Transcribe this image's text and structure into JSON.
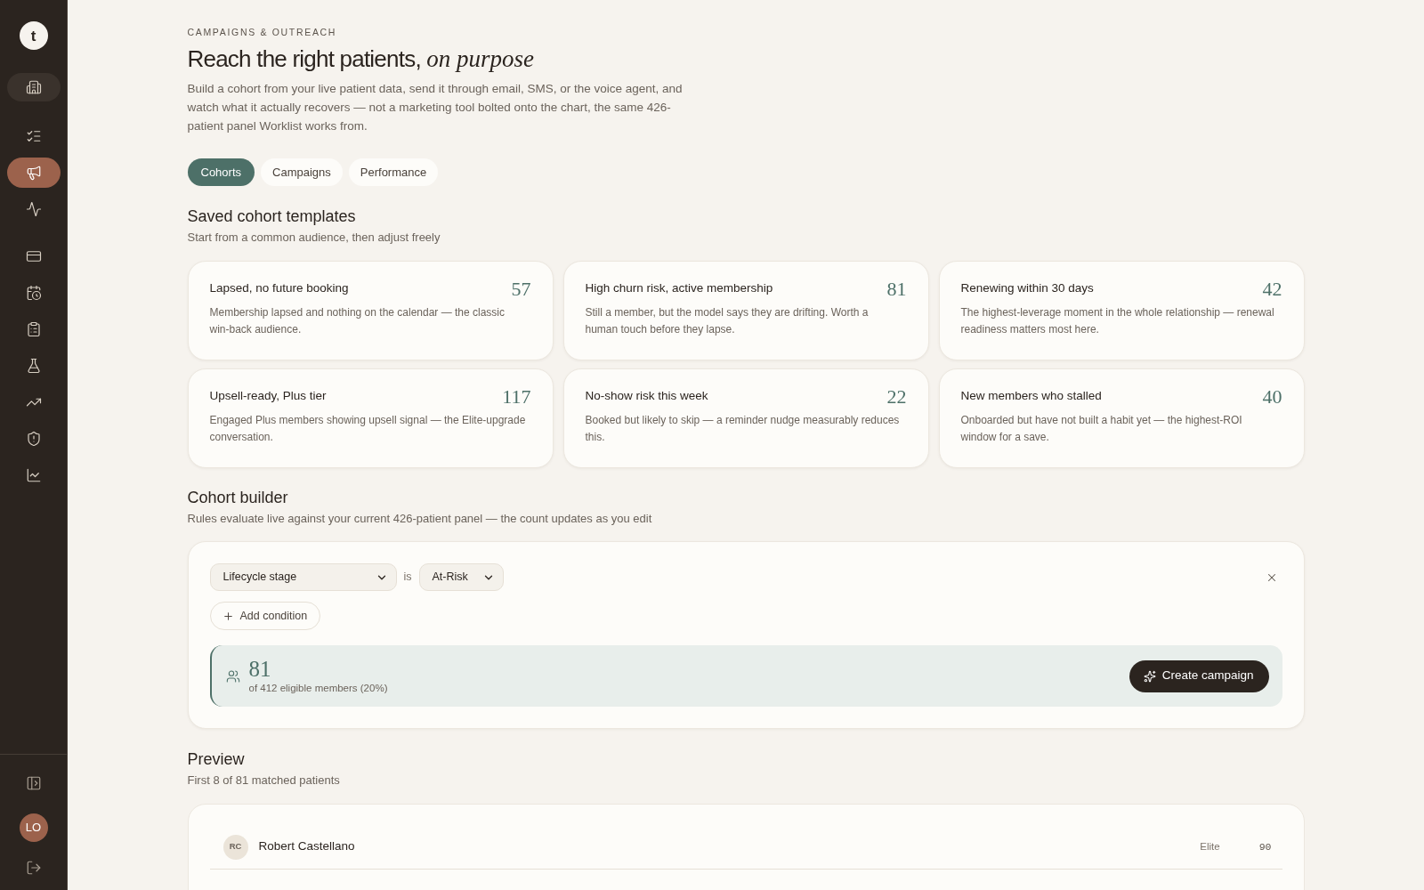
{
  "sidebar": {
    "logo": "t",
    "nav_groups": [
      {
        "items": [
          {
            "selected": false
          },
          {
            "selected": true
          },
          {
            "selected": false
          }
        ]
      },
      {
        "items": [
          {
            "selected": false
          },
          {
            "selected": false
          },
          {
            "selected": false
          },
          {
            "selected": false
          },
          {
            "selected": false
          },
          {
            "selected": false
          },
          {
            "selected": false
          }
        ]
      }
    ],
    "user_initials": "LO"
  },
  "header": {
    "eyebrow": "CAMPAIGNS & OUTREACH",
    "title": "Reach the right patients, *on purpose*",
    "description": "Build a cohort from your live patient data, send it through email, SMS, or the voice agent, and watch what it actually recovers — not a marketing tool bolted onto the chart, the same 426-patient panel Worklist works from."
  },
  "tabs": [
    {
      "label": "Cohorts",
      "selected": true
    },
    {
      "label": "Campaigns",
      "selected": false
    },
    {
      "label": "Performance",
      "selected": false
    }
  ],
  "templates": {
    "title": "Saved cohort templates",
    "subtitle": "Start from a common audience, then adjust freely",
    "cards": [
      {
        "title": "Lapsed, no future booking",
        "count": "57",
        "description": "Membership lapsed and nothing on the calendar — the classic win-back audience."
      },
      {
        "title": "High churn risk, active membership",
        "count": "81",
        "description": "Still a member, but the model says they are drifting. Worth a human touch before they lapse."
      },
      {
        "title": "Renewing within 30 days",
        "count": "42",
        "description": "The highest-leverage moment in the whole relationship — renewal readiness matters most here."
      },
      {
        "title": "Upsell-ready, Plus tier",
        "count": "117",
        "description": "Engaged Plus members showing upsell signal — the Elite-upgrade conversation."
      },
      {
        "title": "No-show risk this week",
        "count": "22",
        "description": "Booked but likely to skip — a reminder nudge measurably reduces this."
      },
      {
        "title": "New members who stalled",
        "count": "40",
        "description": "Onboarded but have not built a habit yet — the highest-ROI window for a save."
      }
    ]
  },
  "builder": {
    "title": "Cohort builder",
    "subtitle": "Rules evaluate live against your current 426-patient panel — the count updates as you edit",
    "conditions": [
      {
        "field": "Lifecycle stage",
        "operator": "is",
        "value": "At-Risk"
      }
    ],
    "add_condition": "Add condition",
    "summary": {
      "count": "81",
      "detail": "of 412 eligible members (20%)"
    },
    "create_button": "Create campaign"
  },
  "preview": {
    "title": "Preview",
    "subtitle": "First 8 of 81 matched patients",
    "rows": [
      {
        "initials": "RC",
        "name": "Robert Castellano",
        "tier": "Elite",
        "score": "90"
      }
    ]
  }
}
